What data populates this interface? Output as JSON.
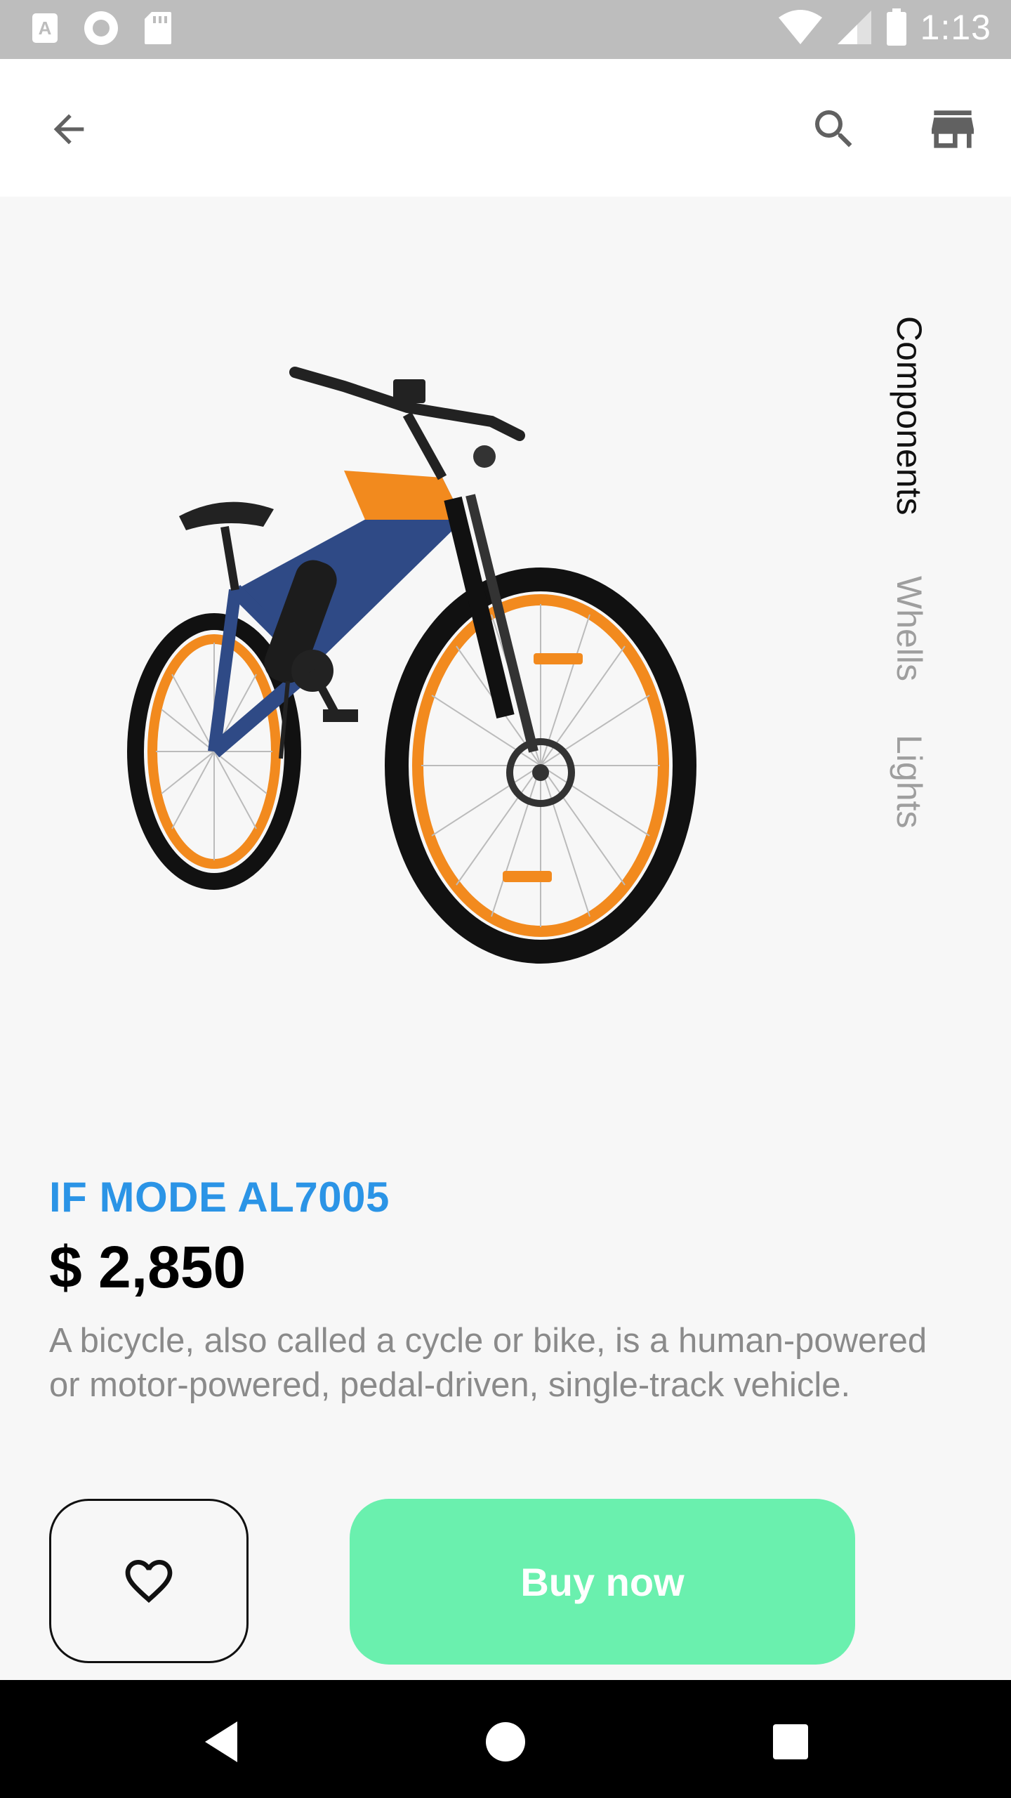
{
  "status_bar": {
    "time": "1:13",
    "left_icons": [
      "accessibility-font-icon",
      "record-icon",
      "sd-card-icon"
    ],
    "right_icons": [
      "wifi-icon",
      "cell-signal-icon",
      "battery-icon"
    ]
  },
  "app_bar": {
    "icons": [
      "arrow-back-icon",
      "search-icon",
      "store-icon"
    ]
  },
  "tabs": [
    {
      "label": "Components",
      "active": true
    },
    {
      "label": "Whells",
      "active": false
    },
    {
      "label": "Lights",
      "active": false
    }
  ],
  "product": {
    "name": "IF MODE AL7005",
    "price": "$ 2,850",
    "description": "A bicycle, also called a cycle or bike, is a human-powered or motor-powered, pedal-driven, single-track vehicle.",
    "image_icon": "bicycle-image"
  },
  "actions": {
    "favorite_icon": "heart-outline-icon",
    "buy_label": "Buy now"
  },
  "colors": {
    "accent_blue": "#2b94e6",
    "buy_green": "#6af0ae",
    "status_bar": "#bdbdbd",
    "tab_active": "#111111",
    "tab_inactive": "#9e9e9e"
  },
  "nav_bar": {
    "icons": [
      "nav-back-icon",
      "nav-home-icon",
      "nav-recents-icon"
    ]
  }
}
